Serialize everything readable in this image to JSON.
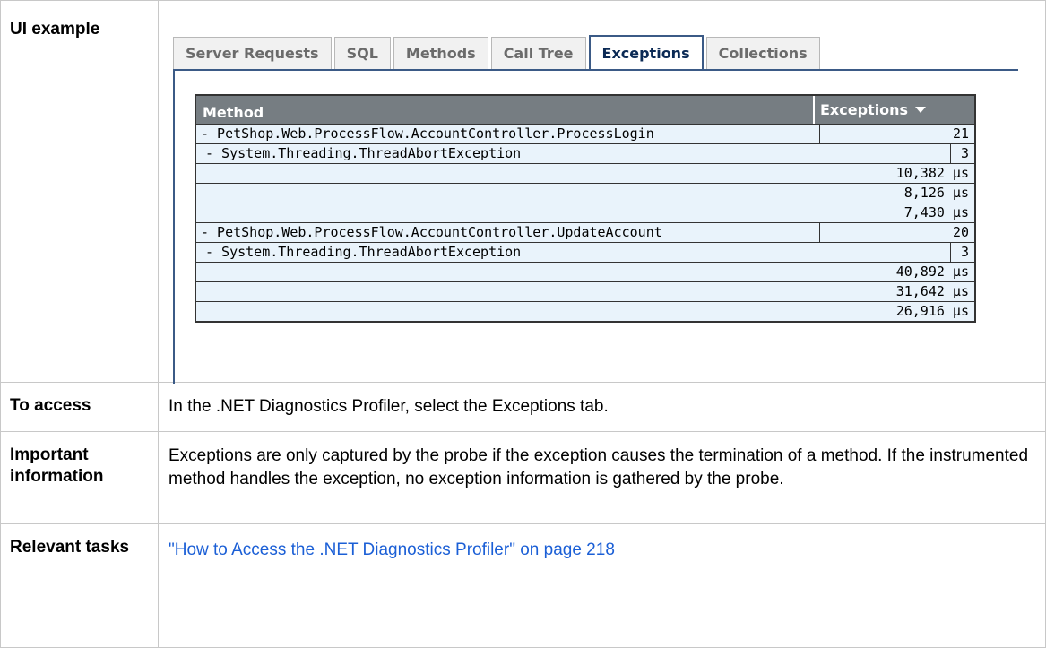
{
  "labels": {
    "ui_example": "UI example",
    "to_access": "To access",
    "important_information": "Important information",
    "relevant_tasks": "Relevant tasks"
  },
  "content": {
    "to_access": "In the .NET Diagnostics Profiler, select the Exceptions tab.",
    "important_information": "Exceptions are only captured by the probe if the exception causes the termination of a method. If the instrumented method handles the exception, no exception information is gathered by the probe.",
    "relevant_tasks_link": "\"How to Access the .NET Diagnostics Profiler\" on page 218"
  },
  "tabs": [
    {
      "label": "Server Requests",
      "active": false
    },
    {
      "label": "SQL",
      "active": false
    },
    {
      "label": "Methods",
      "active": false
    },
    {
      "label": "Call Tree",
      "active": false
    },
    {
      "label": "Exceptions",
      "active": true
    },
    {
      "label": "Collections",
      "active": false
    }
  ],
  "grid": {
    "headers": {
      "method": "Method",
      "exceptions": "Exceptions"
    },
    "rows": [
      {
        "kind": "method",
        "name": "- PetShop.Web.ProcessFlow.AccountController.ProcessLogin",
        "value": "21"
      },
      {
        "kind": "exc",
        "name": "- System.Threading.ThreadAbortException",
        "value": "3"
      },
      {
        "kind": "time",
        "name": "",
        "value": "10,382 µs"
      },
      {
        "kind": "time",
        "name": "",
        "value": "8,126 µs"
      },
      {
        "kind": "time",
        "name": "",
        "value": "7,430 µs"
      },
      {
        "kind": "method",
        "name": "- PetShop.Web.ProcessFlow.AccountController.UpdateAccount",
        "value": "20"
      },
      {
        "kind": "exc",
        "name": "- System.Threading.ThreadAbortException",
        "value": "3"
      },
      {
        "kind": "time",
        "name": "",
        "value": "40,892 µs"
      },
      {
        "kind": "time",
        "name": "",
        "value": "31,642 µs"
      },
      {
        "kind": "time",
        "name": "",
        "value": "26,916 µs"
      }
    ]
  },
  "colors": {
    "link": "#1b5fd6",
    "tab_border": "#3b5a86",
    "grid_header": "#767d82",
    "grid_row_bg": "#e9f3fb"
  }
}
